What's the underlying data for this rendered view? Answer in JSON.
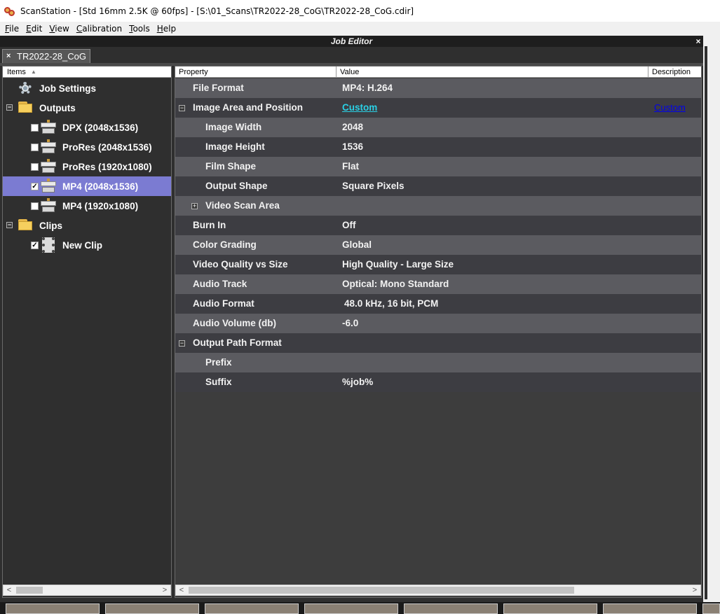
{
  "window": {
    "title": "ScanStation - [Std 16mm 2.5K @ 60fps] - [S:\\01_Scans\\TR2022-28_CoG\\TR2022-28_CoG.cdir]"
  },
  "menu": [
    {
      "label": "File",
      "key": "F",
      "rest": "ile"
    },
    {
      "label": "Edit",
      "key": "E",
      "rest": "dit"
    },
    {
      "label": "View",
      "key": "V",
      "rest": "iew"
    },
    {
      "label": "Calibration",
      "key": "C",
      "rest": "alibration"
    },
    {
      "label": "Tools",
      "key": "T",
      "rest": "ools"
    },
    {
      "label": "Help",
      "key": "H",
      "rest": "elp"
    }
  ],
  "editor": {
    "title": "Job Editor",
    "close": "×",
    "tab_label": "TR2022-28_CoG",
    "tab_close": "×"
  },
  "tree": {
    "header": "Items",
    "sort_glyph": "▲",
    "items": [
      {
        "label": "Job Settings",
        "icon": "gear-icon"
      },
      {
        "label": "Outputs",
        "icon": "folder-icon",
        "expander": "−"
      },
      {
        "label": "DPX (2048x1536)",
        "icon": "output-icon",
        "checked": false
      },
      {
        "label": "ProRes (2048x1536)",
        "icon": "output-icon",
        "checked": false
      },
      {
        "label": "ProRes (1920x1080)",
        "icon": "output-icon",
        "checked": false
      },
      {
        "label": "MP4 (2048x1536)",
        "icon": "output-icon",
        "checked": true,
        "selected": true
      },
      {
        "label": "MP4 (1920x1080)",
        "icon": "output-icon",
        "checked": false
      },
      {
        "label": "Clips",
        "icon": "folder-icon",
        "expander": "−"
      },
      {
        "label": "New Clip",
        "icon": "clip-icon",
        "checked": true
      }
    ],
    "checkmark": "✓"
  },
  "grid": {
    "columns": {
      "property": "Property",
      "value": "Value",
      "description": "Description"
    },
    "rows": [
      {
        "name": "File Format",
        "value": "MP4: H.264"
      },
      {
        "name": "Image Area and Position",
        "value": "Custom",
        "description": "Custom",
        "expander": "−"
      },
      {
        "name": "Image Width",
        "value": "2048"
      },
      {
        "name": "Image Height",
        "value": "1536"
      },
      {
        "name": "Film Shape",
        "value": "Flat"
      },
      {
        "name": "Output Shape",
        "value": "Square Pixels"
      },
      {
        "name": "Video Scan Area",
        "value": "",
        "expander": "+"
      },
      {
        "name": "Burn In",
        "value": "Off"
      },
      {
        "name": "Color Grading",
        "value": "Global"
      },
      {
        "name": "Video Quality vs Size",
        "value": "High Quality - Large Size"
      },
      {
        "name": "Audio Track",
        "value": "Optical: Mono Standard"
      },
      {
        "name": "Audio Format",
        "value": "48.0 kHz, 16 bit, PCM"
      },
      {
        "name": "Audio Volume (db)",
        "value": "-6.0"
      },
      {
        "name": "Output Path Format",
        "value": "",
        "expander": "−"
      },
      {
        "name": "Prefix",
        "value": ""
      },
      {
        "name": "Suffix",
        "value": "%job%"
      }
    ]
  },
  "scroll": {
    "left_arrow": "<",
    "right_arrow": ">"
  },
  "colors": {
    "selected_row": "#7b7bd2",
    "link": "#2ad1e6",
    "description_link": "#0000ee"
  }
}
